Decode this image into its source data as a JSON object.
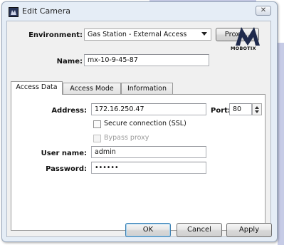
{
  "window": {
    "title": "Edit Camera",
    "close_glyph": "✕"
  },
  "header": {
    "environment_label": "Environment:",
    "environment_value": "Gas Station - External Access",
    "proxy_button": "Proxy...",
    "name_label": "Name:",
    "name_value": "mx-10-9-45-87",
    "logo_text": "MOBOTIX"
  },
  "tabs": [
    {
      "label": "Access Data",
      "active": true
    },
    {
      "label": "Access Mode",
      "active": false
    },
    {
      "label": "Information",
      "active": false
    }
  ],
  "access_data": {
    "address_label": "Address:",
    "address_value": "172.16.250.47",
    "port_label": "Port:",
    "port_value": "80",
    "ssl_label": "Secure connection (SSL)",
    "ssl_checked": false,
    "bypass_label": "Bypass proxy",
    "bypass_checked": false,
    "bypass_enabled": false,
    "username_label": "User name:",
    "username_value": "admin",
    "password_label": "Password:",
    "password_value": "••••••"
  },
  "footer": {
    "ok": "OK",
    "cancel": "Cancel",
    "apply": "Apply"
  }
}
